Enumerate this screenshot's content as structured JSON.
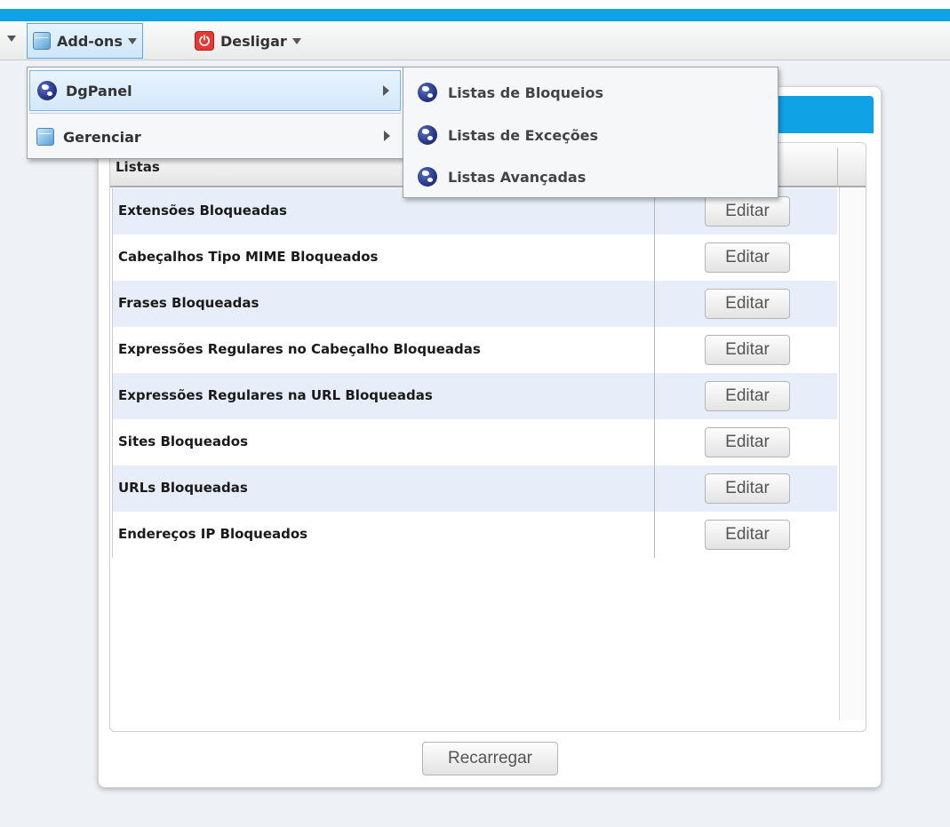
{
  "toolbar": {
    "addons_label": "Add-ons",
    "shutdown_label": "Desligar"
  },
  "addons_menu": {
    "items": [
      {
        "label": "DgPanel",
        "icon": "globe-icon",
        "active": true
      },
      {
        "label": "Gerenciar",
        "icon": "cube-icon",
        "active": false
      }
    ]
  },
  "dgpanel_submenu": {
    "items": [
      {
        "label": "Listas de Bloqueios",
        "icon": "globe-icon"
      },
      {
        "label": "Listas de Exceções",
        "icon": "globe-icon"
      },
      {
        "label": "Listas Avançadas",
        "icon": "globe-icon"
      }
    ]
  },
  "grid": {
    "column_header": "Listas",
    "rows": [
      {
        "name": "Extensões Bloqueadas",
        "action": "Editar"
      },
      {
        "name": "Cabeçalhos Tipo MIME Bloqueados",
        "action": "Editar"
      },
      {
        "name": "Frases Bloqueadas",
        "action": "Editar"
      },
      {
        "name": "Expressões Regulares no Cabeçalho Bloqueadas",
        "action": "Editar"
      },
      {
        "name": "Expressões Regulares na URL Bloqueadas",
        "action": "Editar"
      },
      {
        "name": "Sites Bloqueados",
        "action": "Editar"
      },
      {
        "name": "URLs Bloqueadas",
        "action": "Editar"
      },
      {
        "name": "Endereços IP Bloqueados",
        "action": "Editar"
      }
    ]
  },
  "footer": {
    "reload_label": "Recarregar"
  },
  "colors": {
    "accent": "#0fa3e6",
    "row_alt": "#e8eef9",
    "power": "#e53935"
  }
}
